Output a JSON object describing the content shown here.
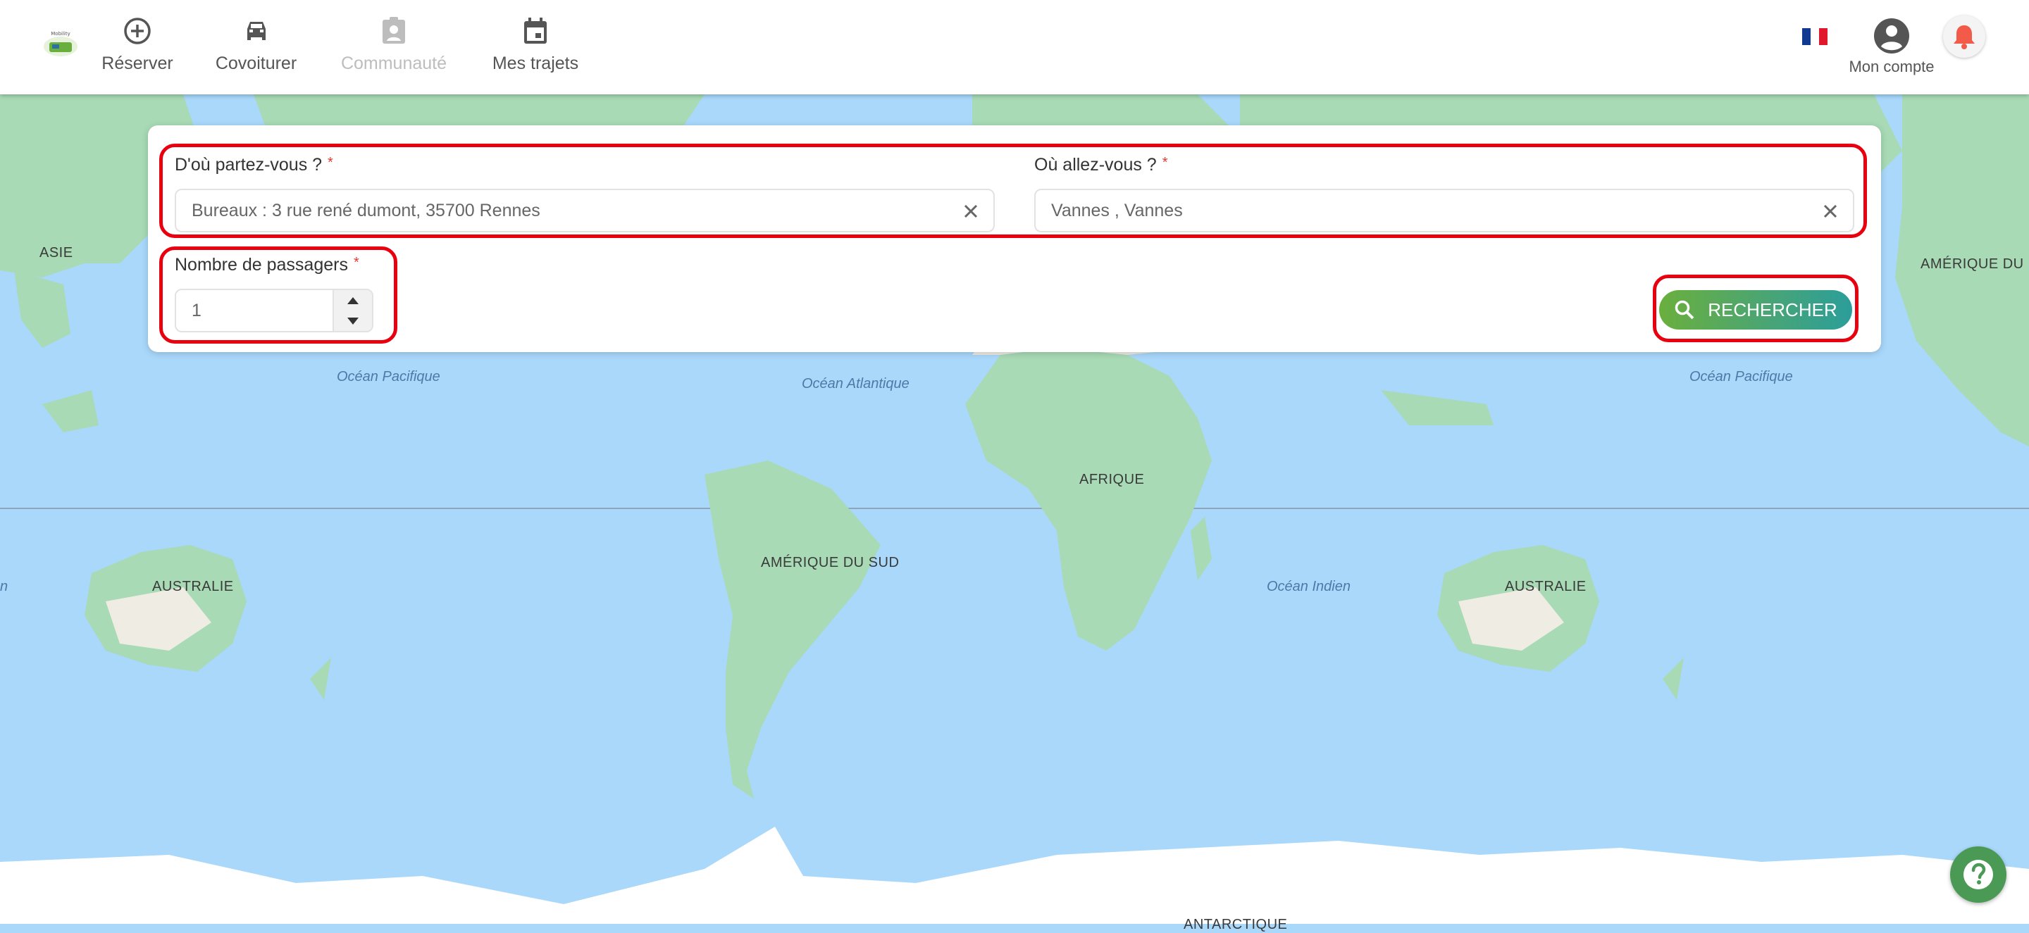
{
  "nav": {
    "items": [
      {
        "label": "Réserver",
        "icon": "plus-circle-icon"
      },
      {
        "label": "Covoiturer",
        "icon": "car-icon"
      },
      {
        "label": "Communauté",
        "icon": "community-icon"
      },
      {
        "label": "Mes trajets",
        "icon": "calendar-icon"
      }
    ],
    "account_label": "Mon compte",
    "language_flag": "fr-flag-icon"
  },
  "search": {
    "from_label": "D'où partez-vous ?",
    "from_value": "Bureaux : 3 rue rené dumont, 35700 Rennes",
    "to_label": "Où allez-vous ?",
    "to_value": "Vannes , Vannes",
    "passengers_label": "Nombre de passagers",
    "passengers_value": "1",
    "required_mark": "*",
    "search_button": "RECHERCHER"
  },
  "map": {
    "labels": {
      "asie": "ASIE",
      "amerique_nord": "AMÉRIQUE DU N",
      "afrique": "AFRIQUE",
      "amerique_sud": "AMÉRIQUE DU SUD",
      "australie_left": "AUSTRALIE",
      "australie_right": "AUSTRALIE",
      "antarctique": "ANTARCTIQUE",
      "n_fragment": "n"
    },
    "oceans": {
      "pacifique_left": "Océan Pacifique",
      "atlantique": "Océan Atlantique",
      "pacifique_right": "Océan Pacifique",
      "indien": "Océan Indien"
    }
  },
  "colors": {
    "accent_red": "#e8000e",
    "button_start": "#6aaf3d",
    "button_end": "#2b9e9a",
    "ocean": "#a9d8fb",
    "land": "#a8dab5"
  }
}
